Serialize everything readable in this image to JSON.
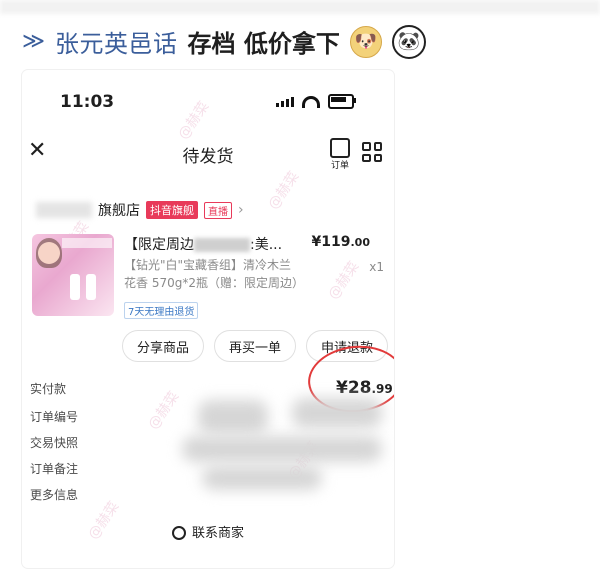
{
  "post": {
    "prefix": "≫",
    "title_blurred": "张元英邑话",
    "tail": "存档 低价拿下"
  },
  "status_bar": {
    "time": "11:03",
    "battery_level": 0.85
  },
  "nav": {
    "title": "待发货",
    "order_icon_label": "订单",
    "close_glyph": "✕"
  },
  "store": {
    "name_suffix": "旗舰店",
    "badge_brand": "抖音旗舰",
    "badge_live": "直播"
  },
  "product": {
    "title_start": "【限定周边",
    "title_end": ":美...",
    "price": "¥119",
    "price_cents": ".00",
    "spec_line1": "【钻光\"白\"宝藏香组】清冷木兰",
    "spec_line2": "花香 570g*2瓶（赠：限定周边）",
    "quantity": "x1",
    "return_tag": "7天无理由退货"
  },
  "actions": {
    "share": "分享商品",
    "buy_again": "再买一单",
    "refund": "申请退款"
  },
  "info": {
    "paid_label": "实付款",
    "paid_amount": "¥28",
    "paid_cents": ".99",
    "order_no_label": "订单编号",
    "snapshot_label": "交易快照",
    "note_label": "订单备注",
    "more_label": "更多信息"
  },
  "contact": {
    "label": "联系商家"
  },
  "watermark": "@赫菜",
  "colors": {
    "accent_red": "#e23a3a",
    "link_blue": "#3b5e9b",
    "badge_red": "#e83a5a"
  }
}
